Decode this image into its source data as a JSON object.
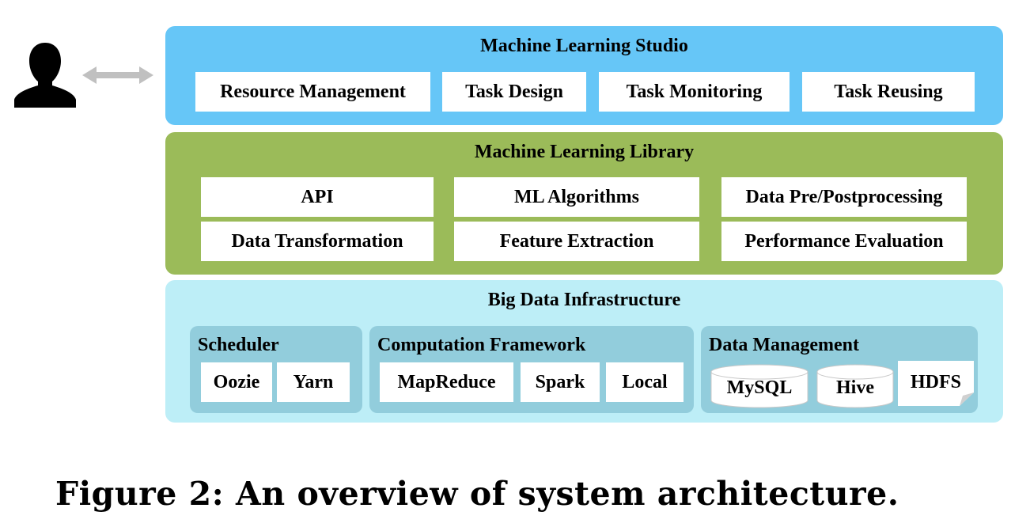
{
  "studio": {
    "title": "Machine Learning Studio",
    "items": [
      "Resource Management",
      "Task Design",
      "Task Monitoring",
      "Task Reusing"
    ]
  },
  "library": {
    "title": "Machine Learning Library",
    "items": [
      "API",
      "ML Algorithms",
      "Data Pre/Postprocessing",
      "Data Transformation",
      "Feature Extraction",
      "Performance Evaluation"
    ]
  },
  "infrastructure": {
    "title": "Big Data Infrastructure",
    "scheduler": {
      "title": "Scheduler",
      "items": [
        "Oozie",
        "Yarn"
      ]
    },
    "computation": {
      "title": "Computation Framework",
      "items": [
        "MapReduce",
        "Spark",
        "Local"
      ]
    },
    "data_management": {
      "title": "Data Management",
      "items": [
        "MySQL",
        "Hive",
        "HDFS"
      ]
    }
  },
  "caption": "Figure 2: An overview of system architecture.",
  "icons": {
    "user": "user-silhouette-icon",
    "arrow": "double-arrow-icon"
  },
  "colors": {
    "studio": "#66c6f7",
    "library": "#9bbb59",
    "infrastructure": "#bdeef7",
    "group": "#92cddc",
    "arrow": "#c0c0c0"
  }
}
